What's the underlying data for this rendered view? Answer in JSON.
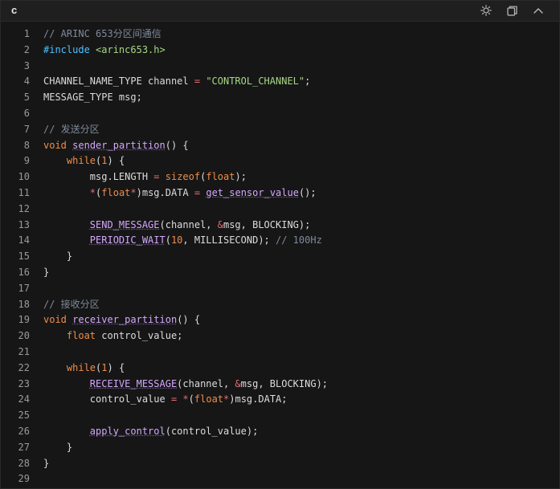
{
  "header": {
    "language": "c",
    "icons": [
      "sun-icon",
      "copy-icon",
      "chevron-up-icon"
    ]
  },
  "code": {
    "lines": [
      {
        "n": "1",
        "tokens": [
          {
            "t": "// ARINC 653分区间通信",
            "c": "comment"
          }
        ]
      },
      {
        "n": "2",
        "tokens": [
          {
            "t": "#include ",
            "c": "pre"
          },
          {
            "t": "<arinc653.h>",
            "c": "str"
          }
        ]
      },
      {
        "n": "3",
        "tokens": []
      },
      {
        "n": "4",
        "tokens": [
          {
            "t": "CHANNEL_NAME_TYPE channel ",
            "c": "plain"
          },
          {
            "t": "=",
            "c": "op"
          },
          {
            "t": " ",
            "c": "plain"
          },
          {
            "t": "\"CONTROL_CHANNEL\"",
            "c": "str"
          },
          {
            "t": ";",
            "c": "plain"
          }
        ]
      },
      {
        "n": "5",
        "tokens": [
          {
            "t": "MESSAGE_TYPE msg;",
            "c": "plain"
          }
        ]
      },
      {
        "n": "6",
        "tokens": []
      },
      {
        "n": "7",
        "tokens": [
          {
            "t": "// 发送分区",
            "c": "comment"
          }
        ]
      },
      {
        "n": "8",
        "tokens": [
          {
            "t": "void",
            "c": "kw"
          },
          {
            "t": " ",
            "c": "plain"
          },
          {
            "t": "sender_partition",
            "c": "fn"
          },
          {
            "t": "() {",
            "c": "plain"
          }
        ]
      },
      {
        "n": "9",
        "tokens": [
          {
            "t": "    ",
            "c": "plain"
          },
          {
            "t": "while",
            "c": "kw"
          },
          {
            "t": "(",
            "c": "plain"
          },
          {
            "t": "1",
            "c": "num"
          },
          {
            "t": ") {",
            "c": "plain"
          }
        ]
      },
      {
        "n": "10",
        "tokens": [
          {
            "t": "        msg.LENGTH ",
            "c": "plain"
          },
          {
            "t": "=",
            "c": "op"
          },
          {
            "t": " ",
            "c": "plain"
          },
          {
            "t": "sizeof",
            "c": "kw"
          },
          {
            "t": "(",
            "c": "plain"
          },
          {
            "t": "float",
            "c": "kw"
          },
          {
            "t": ");",
            "c": "plain"
          }
        ]
      },
      {
        "n": "11",
        "tokens": [
          {
            "t": "        ",
            "c": "plain"
          },
          {
            "t": "*",
            "c": "op"
          },
          {
            "t": "(",
            "c": "plain"
          },
          {
            "t": "float",
            "c": "kw"
          },
          {
            "t": "*",
            "c": "op"
          },
          {
            "t": ")msg.DATA ",
            "c": "plain"
          },
          {
            "t": "=",
            "c": "op"
          },
          {
            "t": " ",
            "c": "plain"
          },
          {
            "t": "get_sensor_value",
            "c": "fn"
          },
          {
            "t": "();",
            "c": "plain"
          }
        ]
      },
      {
        "n": "12",
        "tokens": []
      },
      {
        "n": "13",
        "tokens": [
          {
            "t": "        ",
            "c": "plain"
          },
          {
            "t": "SEND_MESSAGE",
            "c": "fn"
          },
          {
            "t": "(channel, ",
            "c": "plain"
          },
          {
            "t": "&",
            "c": "op"
          },
          {
            "t": "msg, BLOCKING);",
            "c": "plain"
          }
        ]
      },
      {
        "n": "14",
        "tokens": [
          {
            "t": "        ",
            "c": "plain"
          },
          {
            "t": "PERIODIC_WAIT",
            "c": "fn"
          },
          {
            "t": "(",
            "c": "plain"
          },
          {
            "t": "10",
            "c": "num"
          },
          {
            "t": ", MILLISECOND); ",
            "c": "plain"
          },
          {
            "t": "// 100Hz",
            "c": "comment"
          }
        ]
      },
      {
        "n": "15",
        "tokens": [
          {
            "t": "    }",
            "c": "plain"
          }
        ]
      },
      {
        "n": "16",
        "tokens": [
          {
            "t": "}",
            "c": "plain"
          }
        ]
      },
      {
        "n": "17",
        "tokens": []
      },
      {
        "n": "18",
        "tokens": [
          {
            "t": "// 接收分区",
            "c": "comment"
          }
        ]
      },
      {
        "n": "19",
        "tokens": [
          {
            "t": "void",
            "c": "kw"
          },
          {
            "t": " ",
            "c": "plain"
          },
          {
            "t": "receiver_partition",
            "c": "fn"
          },
          {
            "t": "() {",
            "c": "plain"
          }
        ]
      },
      {
        "n": "20",
        "tokens": [
          {
            "t": "    ",
            "c": "plain"
          },
          {
            "t": "float",
            "c": "kw"
          },
          {
            "t": " control_value;",
            "c": "plain"
          }
        ]
      },
      {
        "n": "21",
        "tokens": []
      },
      {
        "n": "22",
        "tokens": [
          {
            "t": "    ",
            "c": "plain"
          },
          {
            "t": "while",
            "c": "kw"
          },
          {
            "t": "(",
            "c": "plain"
          },
          {
            "t": "1",
            "c": "num"
          },
          {
            "t": ") {",
            "c": "plain"
          }
        ]
      },
      {
        "n": "23",
        "tokens": [
          {
            "t": "        ",
            "c": "plain"
          },
          {
            "t": "RECEIVE_MESSAGE",
            "c": "fn"
          },
          {
            "t": "(channel, ",
            "c": "plain"
          },
          {
            "t": "&",
            "c": "op"
          },
          {
            "t": "msg, BLOCKING);",
            "c": "plain"
          }
        ]
      },
      {
        "n": "24",
        "tokens": [
          {
            "t": "        control_value ",
            "c": "plain"
          },
          {
            "t": "=",
            "c": "op"
          },
          {
            "t": " ",
            "c": "plain"
          },
          {
            "t": "*",
            "c": "op"
          },
          {
            "t": "(",
            "c": "plain"
          },
          {
            "t": "float",
            "c": "kw"
          },
          {
            "t": "*",
            "c": "op"
          },
          {
            "t": ")msg.DATA;",
            "c": "plain"
          }
        ]
      },
      {
        "n": "25",
        "tokens": []
      },
      {
        "n": "26",
        "tokens": [
          {
            "t": "        ",
            "c": "plain"
          },
          {
            "t": "apply_control",
            "c": "fn"
          },
          {
            "t": "(control_value);",
            "c": "plain"
          }
        ]
      },
      {
        "n": "27",
        "tokens": [
          {
            "t": "    }",
            "c": "plain"
          }
        ]
      },
      {
        "n": "28",
        "tokens": [
          {
            "t": "}",
            "c": "plain"
          }
        ]
      },
      {
        "n": "29",
        "tokens": []
      }
    ]
  }
}
